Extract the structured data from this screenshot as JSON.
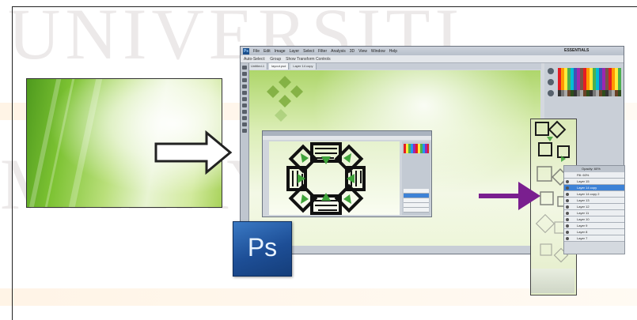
{
  "watermark": {
    "line1": "UNIVERSITI",
    "line2": "MALAYSIA"
  },
  "photoshop": {
    "logo_text": "Ps",
    "menu": [
      "File",
      "Edit",
      "Image",
      "Layer",
      "Select",
      "Filter",
      "Analysis",
      "3D",
      "View",
      "Window",
      "Help"
    ],
    "workspace_label": "ESSENTIALS",
    "doc_tabs": [
      "Untitled-1",
      "layout.psd",
      "Layer 14 copy"
    ],
    "options_bar": [
      "Auto-Select:",
      "Group",
      "Show Transform Controls"
    ]
  },
  "layers_panel": {
    "opacity_label": "Opacity:",
    "opacity_value": "60%",
    "fill_label": "Fill:",
    "fill_value": "60%",
    "rows": [
      "Layer 15",
      "Layer 14 copy",
      "Layer 14 copy 2",
      "Layer 13",
      "Layer 12",
      "Layer 11",
      "Layer 10",
      "Layer 9",
      "Layer 8",
      "Layer 7"
    ]
  },
  "arrows": {
    "white_color": "#ffffff",
    "purple_color": "#7a1f8f"
  },
  "colors": {
    "ps_blue": "#1d4e96",
    "green": "#7cc232"
  }
}
